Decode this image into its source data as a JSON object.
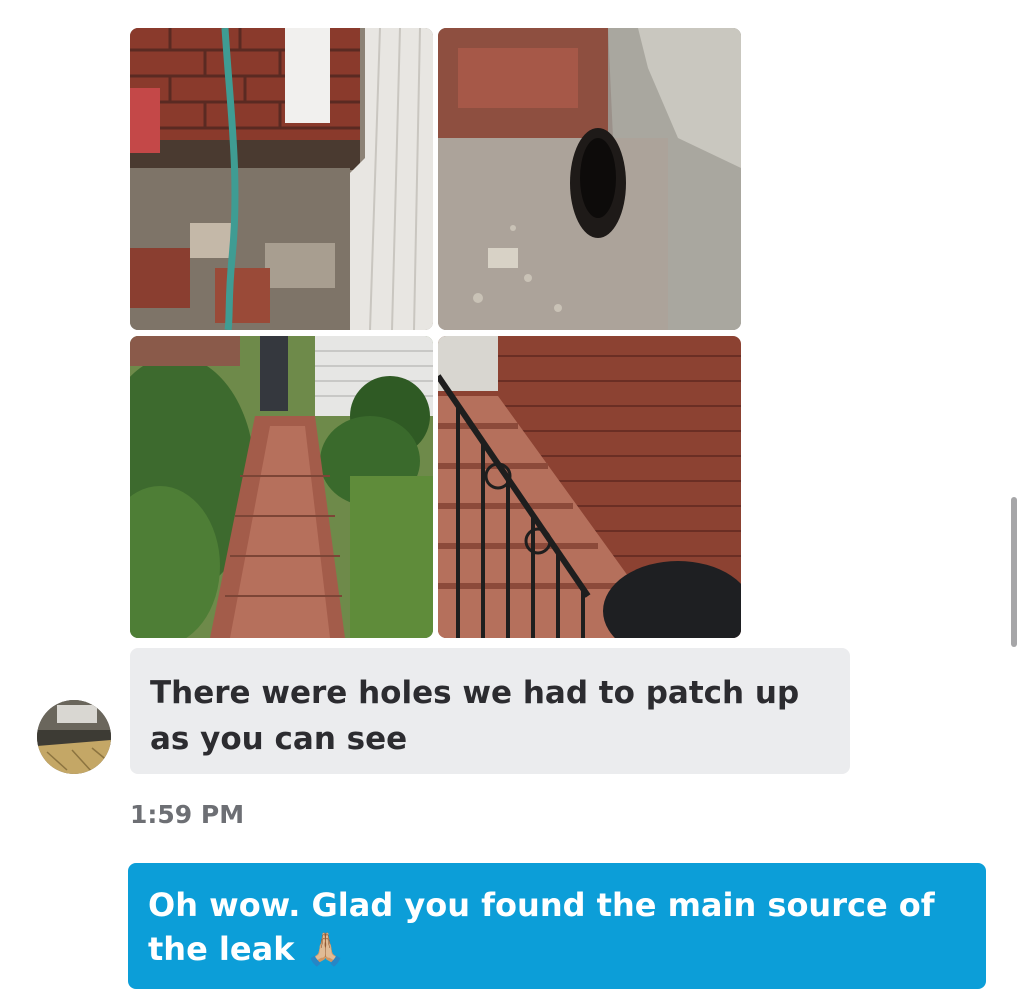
{
  "thread": {
    "photos": [
      {
        "name": "brick-wall-hose-debris-photo"
      },
      {
        "name": "foundation-hole-photo"
      },
      {
        "name": "brick-walkway-photo"
      },
      {
        "name": "brick-stairs-railing-photo"
      }
    ],
    "incoming_message": {
      "text": "There were holes we had to patch up as you can see"
    },
    "timestamp": "1:59 PM",
    "outgoing_message": {
      "text": "Oh wow. Glad you found the main source of the leak 🙏🏼"
    }
  },
  "colors": {
    "incoming_bubble": "#ebecee",
    "outgoing_bubble": "#0c9ed8",
    "timestamp": "#6d6f74",
    "scrollbar": "#a6a6a8"
  }
}
